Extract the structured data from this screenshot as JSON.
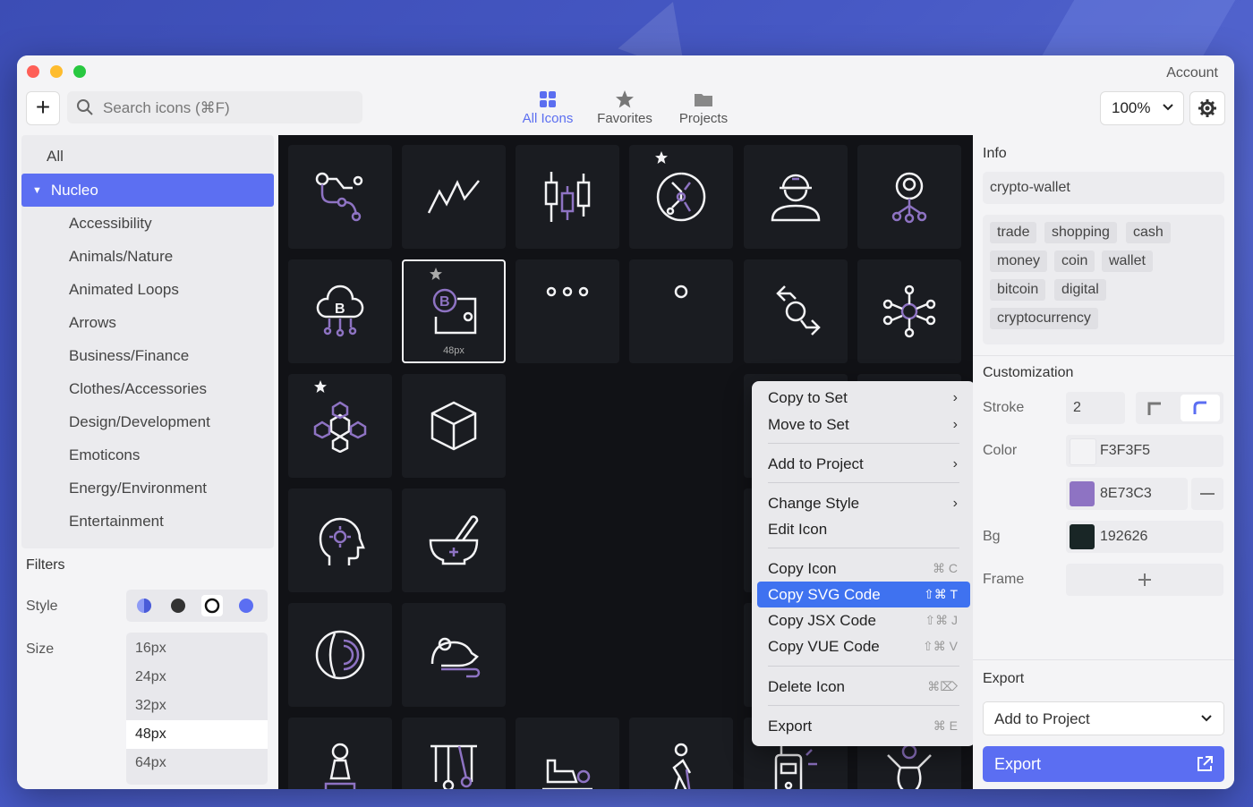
{
  "titlebar": {
    "account": "Account"
  },
  "search": {
    "placeholder": "Search icons (⌘F)"
  },
  "nav": [
    {
      "label": "All Icons"
    },
    {
      "label": "Favorites"
    },
    {
      "label": "Projects"
    }
  ],
  "zoom": "100%",
  "sidebar": {
    "all": "All",
    "selected": "Nucleo",
    "items": [
      {
        "label": "Accessibility"
      },
      {
        "label": "Animals/Nature"
      },
      {
        "label": "Animated Loops"
      },
      {
        "label": "Arrows"
      },
      {
        "label": "Business/Finance"
      },
      {
        "label": "Clothes/Accessories"
      },
      {
        "label": "Design/Development"
      },
      {
        "label": "Emoticons"
      },
      {
        "label": "Energy/Environment"
      },
      {
        "label": "Entertainment"
      }
    ],
    "filters_title": "Filters",
    "style_label": "Style",
    "size_label": "Size",
    "sizes": [
      "16px",
      "24px",
      "32px",
      "48px",
      "64px"
    ],
    "selected_size": "48px"
  },
  "grid": {
    "selected_size_label": "48px"
  },
  "context_menu": {
    "items": [
      {
        "label": "Copy to Set",
        "sub": "›"
      },
      {
        "label": "Move to Set",
        "sub": "›"
      },
      {
        "label": "Add to Project",
        "sub": "›"
      },
      {
        "label": "Change Style",
        "sub": "›"
      },
      {
        "label": "Edit Icon"
      },
      {
        "label": "Copy Icon",
        "shortcut": "⌘ C"
      },
      {
        "label": "Copy SVG Code",
        "shortcut": "⇧⌘ T"
      },
      {
        "label": "Copy JSX Code",
        "shortcut": "⇧⌘ J"
      },
      {
        "label": "Copy VUE Code",
        "shortcut": "⇧⌘ V"
      },
      {
        "label": "Delete Icon",
        "shortcut": "⌘⌦"
      },
      {
        "label": "Export",
        "shortcut": "⌘ E"
      }
    ]
  },
  "info": {
    "title": "Info",
    "name": "crypto-wallet",
    "tags": [
      "trade",
      "shopping",
      "cash",
      "money",
      "coin",
      "wallet",
      "bitcoin",
      "digital",
      "cryptocurrency"
    ]
  },
  "customization": {
    "title": "Customization",
    "stroke_label": "Stroke",
    "stroke_value": "2",
    "color_label": "Color",
    "color1": "F3F3F5",
    "color2": "8E73C3",
    "bg_label": "Bg",
    "bg_value": "192626",
    "frame_label": "Frame"
  },
  "export": {
    "title": "Export",
    "select_value": "Add to Project",
    "button_label": "Export"
  },
  "colors": {
    "accent": "#5b6ef2",
    "icon_stroke": "#f3f3f5",
    "icon_accent": "#8e73c3",
    "icon_bg": "#1a1c21"
  }
}
